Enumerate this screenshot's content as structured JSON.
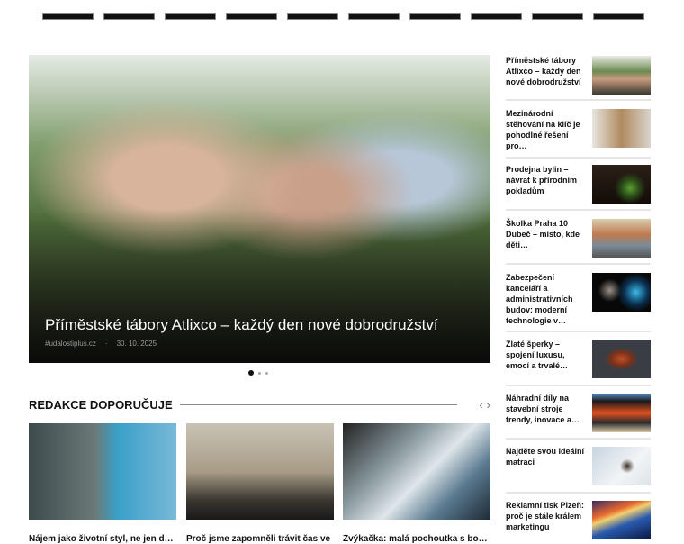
{
  "nav": {
    "count": 10
  },
  "hero": {
    "title": "Příměstské tábory Atlixco – každý den nové dobrodružství",
    "source": "#udalostiplus.cz",
    "date": "30. 10. 2025",
    "slides": 3,
    "active_slide": 1
  },
  "section": {
    "title": "REDAKCE DOPORUČUJE",
    "prev": "‹",
    "next": "›"
  },
  "cards": [
    {
      "caption": "Nájem jako životní styl, ne jen dočasné…"
    },
    {
      "caption": "Proč jsme zapomněli trávit čas ve"
    },
    {
      "caption": "Žvýkačka: malá pochoutka s bohatou"
    }
  ],
  "sidebar": [
    {
      "title": "Příměstské tábory Atlixco – každý den nové dobrodružství"
    },
    {
      "title": "Mezinárodní stěhování na klíč je pohodlné řešení pro…"
    },
    {
      "title": "Prodejna bylin – návrat k přírodním pokladům"
    },
    {
      "title": "Školka Praha 10 Dubeč – místo, kde děti…"
    },
    {
      "title": "Zabezpečení kanceláří a administrativních budov: moderní technologie v…"
    },
    {
      "title": "Zlaté šperky – spojení luxusu, emocí a trvalé…"
    },
    {
      "title": "Náhradní díly na stavební stroje trendy, inovace a…"
    },
    {
      "title": "Najděte svou ideální matraci"
    },
    {
      "title": "Reklamní tisk Plzeň: proč je stále králem marketingu"
    }
  ]
}
